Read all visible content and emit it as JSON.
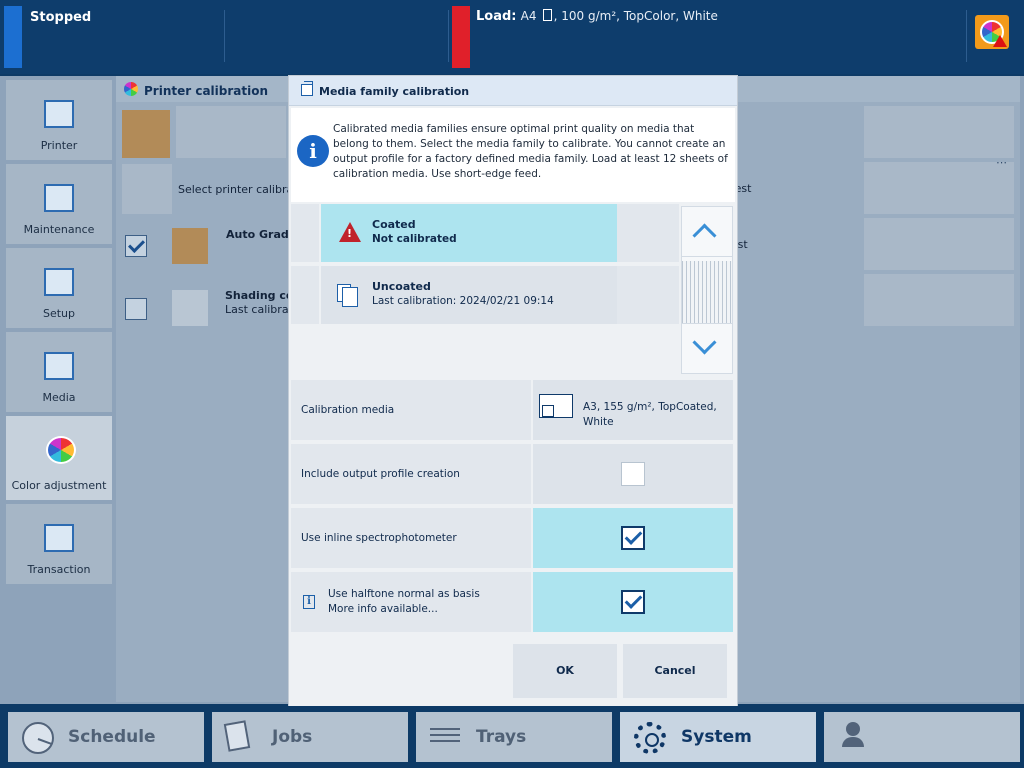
{
  "topbar": {
    "status": "Stopped",
    "load_label": "Load:",
    "load_size": "A4",
    "load_media": ", 100 g/m², TopColor, White",
    "alert_icon": "color-wheel-warning-icon"
  },
  "sidebar": {
    "items": [
      {
        "label": "Printer",
        "icon": "printer-icon"
      },
      {
        "label": "Maintenance",
        "icon": "maintenance-icon"
      },
      {
        "label": "Setup",
        "icon": "setup-icon"
      },
      {
        "label": "Media",
        "icon": "media-icon"
      },
      {
        "label": "Color adjustment",
        "icon": "color-wheel-icon",
        "active": true
      },
      {
        "label": "Transaction",
        "icon": "transaction-icon"
      }
    ]
  },
  "background": {
    "header": "Printer calibration",
    "select_text": "Select printer calibratio",
    "auto_text": "Auto Grada",
    "shading_title": "Shading co",
    "shading_sub": "Last calibratio",
    "right1": "e test",
    "right2": "l test",
    "ellipsis": "⋯"
  },
  "dialog": {
    "title": "Media family calibration",
    "info": "Calibrated media families ensure optimal print quality on media that belong to them. Select the media family to calibrate. You cannot create an output profile for a factory defined media family. Load at least 12 sheets of calibration media. Use short-edge feed.",
    "families": [
      {
        "name": "Coated",
        "status": "Not calibrated",
        "selected": true
      },
      {
        "name": "Uncoated",
        "status": "Last calibration: 2024/02/21 09:14",
        "selected": false
      }
    ],
    "settings": {
      "calibration_media_label": "Calibration media",
      "calibration_media_value": "A3, 155 g/m², TopCoated, White",
      "output_profile_label": "Include output profile creation",
      "output_profile_checked": false,
      "inline_spectro_label": "Use inline spectrophotometer",
      "inline_spectro_checked": true,
      "halftone_label": "Use halftone normal as basis",
      "halftone_more": "More info available...",
      "halftone_checked": true
    },
    "ok": "OK",
    "cancel": "Cancel"
  },
  "bottom_nav": {
    "tabs": [
      {
        "label": "Schedule",
        "icon": "clock-icon"
      },
      {
        "label": "Jobs",
        "icon": "jobs-icon"
      },
      {
        "label": "Trays",
        "icon": "trays-icon"
      },
      {
        "label": "System",
        "icon": "gear-icon",
        "active": true
      },
      {
        "label": "",
        "icon": "user-key-icon"
      }
    ]
  },
  "colors": {
    "top_bar": "#0e3d6c",
    "selected": "#ade4ef",
    "accent": "#1b66c4",
    "stop_indicator": "#1c6fd1",
    "load_indicator": "#e0202a"
  }
}
